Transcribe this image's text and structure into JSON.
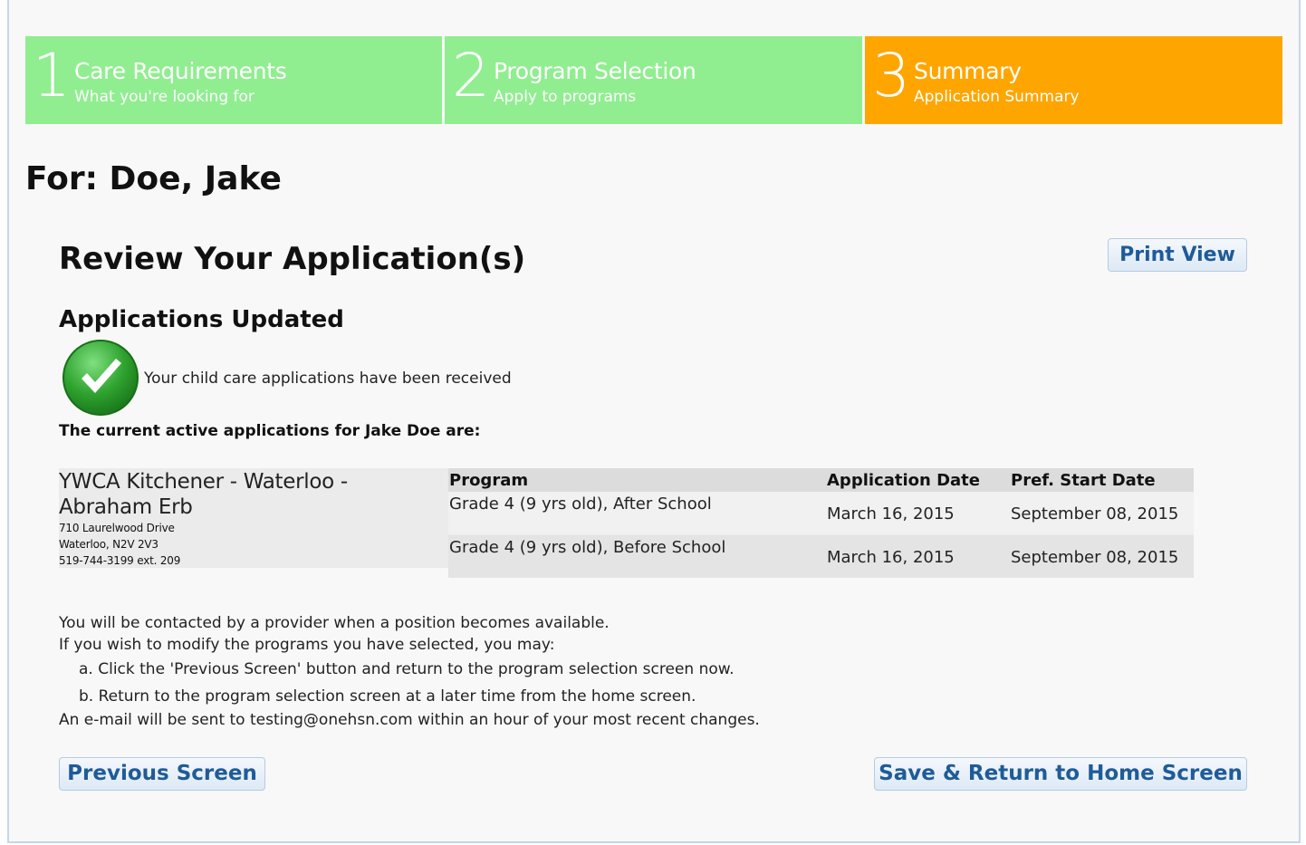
{
  "steps": [
    {
      "number": "1",
      "title": "Care Requirements",
      "subtitle": "What you're looking for",
      "color": "#90ee90"
    },
    {
      "number": "2",
      "title": "Program Selection",
      "subtitle": "Apply to programs",
      "color": "#90ee90"
    },
    {
      "number": "3",
      "title": "Summary",
      "subtitle": "Application Summary",
      "color": "#ffa500"
    }
  ],
  "for_line": "For: Doe, Jake",
  "review_title": "Review Your Application(s)",
  "print_button": "Print View",
  "updated_heading": "Applications Updated",
  "received_message": "Your child care applications have been received",
  "active_line": "The current active applications for Jake Doe are:",
  "provider": {
    "name": "YWCA Kitchener - Waterloo - Abraham Erb",
    "address_line1": "710 Laurelwood Drive",
    "address_line2": "Waterloo, N2V 2V3",
    "phone": "519-744-3199 ext. 209"
  },
  "programs": {
    "headers": [
      "Program",
      "Application Date",
      "Pref. Start Date"
    ],
    "rows": [
      [
        "Grade 4 (9 yrs old), After School",
        "March 16, 2015",
        "September 08, 2015"
      ],
      [
        "Grade 4 (9 yrs old), Before School",
        "March 16, 2015",
        "September 08, 2015"
      ]
    ]
  },
  "notes": [
    "You will be contacted by a provider when a position becomes available.",
    "If you wish to modify the programs you have selected, you may:",
    "a. Click the 'Previous Screen' button and return to the program selection screen now.",
    "b. Return to the program selection screen at a later time from the home screen.",
    "An e-mail will be sent to testing@onehsn.com within an hour of your most recent changes."
  ],
  "buttons": {
    "previous": "Previous Screen",
    "save": "Save & Return to Home Screen"
  }
}
